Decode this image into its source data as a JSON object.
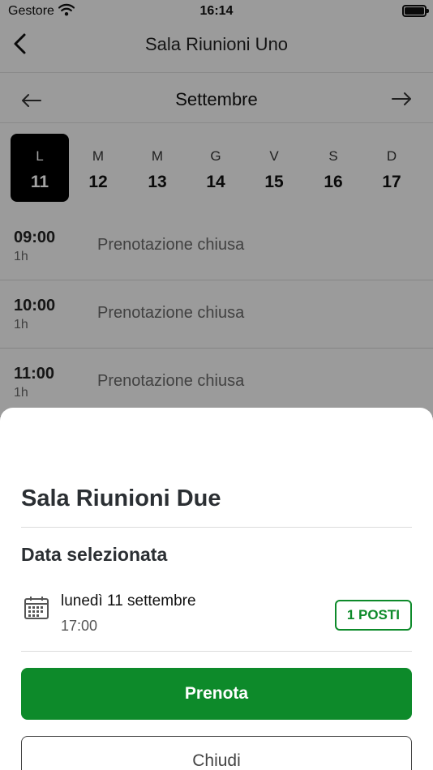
{
  "status_bar": {
    "carrier": "Gestore",
    "time": "16:14",
    "wifi_icon": "wifi-icon",
    "battery_icon": "battery-icon"
  },
  "nav": {
    "title": "Sala Riunioni Uno",
    "back_icon": "chevron-left-icon"
  },
  "calendar": {
    "month": "Settembre",
    "prev_icon": "arrow-left-icon",
    "next_icon": "arrow-right-icon",
    "days": [
      {
        "letter": "L",
        "number": "11",
        "selected": true
      },
      {
        "letter": "M",
        "number": "12"
      },
      {
        "letter": "M",
        "number": "13"
      },
      {
        "letter": "G",
        "number": "14"
      },
      {
        "letter": "V",
        "number": "15"
      },
      {
        "letter": "S",
        "number": "16"
      },
      {
        "letter": "D",
        "number": "17"
      }
    ]
  },
  "slots": [
    {
      "time": "09:00",
      "duration": "1h",
      "status": "Prenotazione chiusa"
    },
    {
      "time": "10:00",
      "duration": "1h",
      "status": "Prenotazione chiusa"
    },
    {
      "time": "11:00",
      "duration": "1h",
      "status": "Prenotazione chiusa"
    }
  ],
  "sheet": {
    "room": "Sala Riunioni Due",
    "section_title": "Data selezionata",
    "date": "lunedì 11 settembre",
    "time": "17:00",
    "seats_badge": "1 POSTI",
    "book_label": "Prenota",
    "close_label": "Chiudi",
    "calendar_icon": "calendar-icon"
  },
  "colors": {
    "accent": "#0d8a2a",
    "selected_day_bg": "#000000"
  }
}
